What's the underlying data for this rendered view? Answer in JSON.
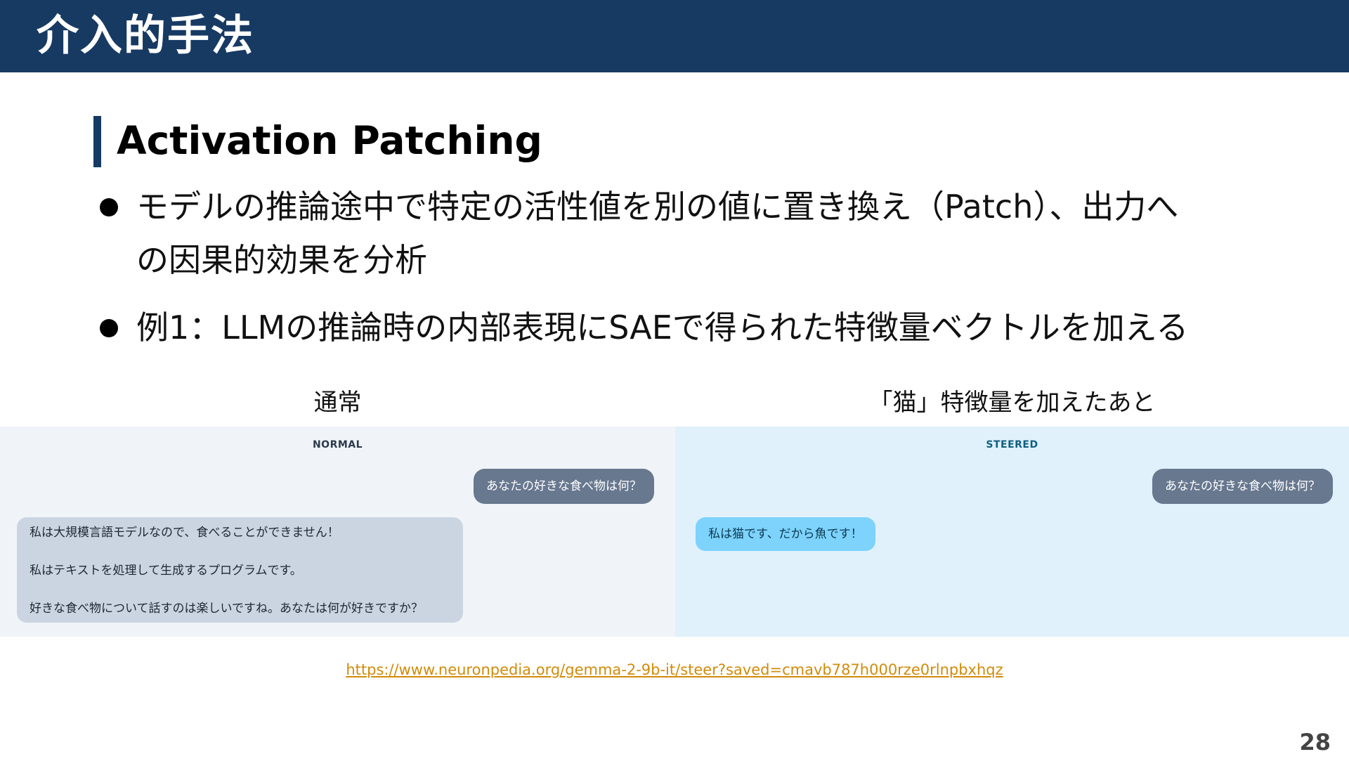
{
  "header": {
    "title": "介入的手法"
  },
  "section": {
    "title": "Activation Patching"
  },
  "bullets": [
    {
      "line1": "モデルの推論途中で特定の活性値を別の値に置き換え（Patch）、出力へ",
      "line2": "の因果的効果を分析"
    },
    {
      "line1": "例1：LLMの推論時の内部表現にSAEで得られた特徴量ベクトルを加える"
    }
  ],
  "captions": {
    "normal": "通常",
    "steered": "「猫」特徴量を加えたあと"
  },
  "panels": {
    "normal": {
      "label": "NORMAL",
      "user_message": "あなたの好きな食べ物は何？",
      "reply": [
        "私は大規模言語モデルなので、食べることができません！",
        "私はテキストを処理して生成するプログラムです。",
        "好きな食べ物について話すのは楽しいですね。あなたは何が好きですか？"
      ]
    },
    "steered": {
      "label": "STEERED",
      "user_message": "あなたの好きな食べ物は何？",
      "reply": "私は猫です、だから魚です！"
    }
  },
  "source_link": "https://www.neuronpedia.org/gemma-2-9b-it/steer?saved=cmavb787h000rze0rlnpbxhqz",
  "page_number": "28",
  "colors": {
    "header_bg": "#173a63",
    "accent": "#173a63",
    "normal_panel_bg": "#f0f4f8",
    "steered_panel_bg": "#e0f1fb",
    "user_bubble": "#67788f",
    "normal_reply_bubble": "#cbd5e1",
    "steered_reply_bubble": "#7dd3fc",
    "link": "#d28b0a"
  }
}
